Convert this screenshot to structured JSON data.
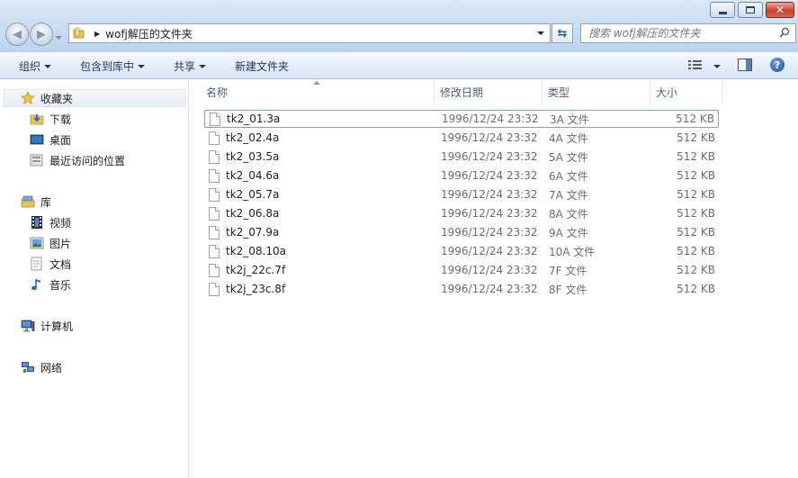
{
  "window": {
    "controls": {
      "minimize_icon": "minimize-icon",
      "maximize_icon": "maximize-icon",
      "close_icon": "close-icon"
    }
  },
  "address": {
    "path": "wofj解压的文件夹"
  },
  "search": {
    "placeholder": "搜索 wofj解压的文件夹"
  },
  "toolbar": {
    "organize": "组织",
    "include_in_library": "包含到库中",
    "share": "共享",
    "new_folder": "新建文件夹"
  },
  "nav": {
    "favorites": "收藏夹",
    "downloads": "下载",
    "desktop": "桌面",
    "recent": "最近访问的位置",
    "libraries": "库",
    "videos": "视频",
    "pictures": "图片",
    "documents": "文档",
    "music": "音乐",
    "computer": "计算机",
    "network": "网络"
  },
  "columns": {
    "name": "名称",
    "modified": "修改日期",
    "type": "类型",
    "size": "大小"
  },
  "files": [
    {
      "name": "tk2_01.3a",
      "modified": "1996/12/24 23:32",
      "type": "3A 文件",
      "size": "512 KB"
    },
    {
      "name": "tk2_02.4a",
      "modified": "1996/12/24 23:32",
      "type": "4A 文件",
      "size": "512 KB"
    },
    {
      "name": "tk2_03.5a",
      "modified": "1996/12/24 23:32",
      "type": "5A 文件",
      "size": "512 KB"
    },
    {
      "name": "tk2_04.6a",
      "modified": "1996/12/24 23:32",
      "type": "6A 文件",
      "size": "512 KB"
    },
    {
      "name": "tk2_05.7a",
      "modified": "1996/12/24 23:32",
      "type": "7A 文件",
      "size": "512 KB"
    },
    {
      "name": "tk2_06.8a",
      "modified": "1996/12/24 23:32",
      "type": "8A 文件",
      "size": "512 KB"
    },
    {
      "name": "tk2_07.9a",
      "modified": "1996/12/24 23:32",
      "type": "9A 文件",
      "size": "512 KB"
    },
    {
      "name": "tk2_08.10a",
      "modified": "1996/12/24 23:32",
      "type": "10A 文件",
      "size": "512 KB"
    },
    {
      "name": "tk2j_22c.7f",
      "modified": "1996/12/24 23:32",
      "type": "7F 文件",
      "size": "512 KB"
    },
    {
      "name": "tk2j_23c.8f",
      "modified": "1996/12/24 23:32",
      "type": "8F 文件",
      "size": "512 KB"
    }
  ],
  "colors": {
    "accent": "#1e395b",
    "selection_border": "#7da2ce",
    "titlebar": "#c7dcf2"
  }
}
